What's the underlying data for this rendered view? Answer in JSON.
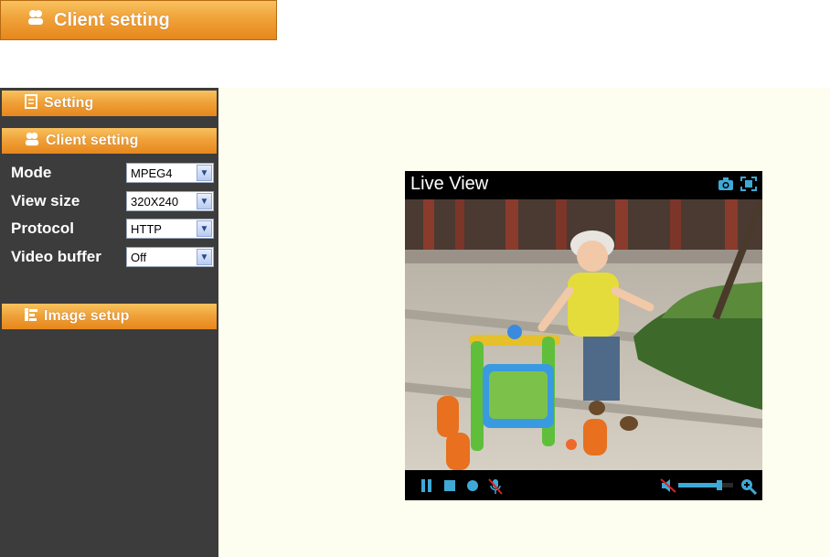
{
  "banner": {
    "title": "Client setting"
  },
  "sidebar": {
    "setting_label": "Setting",
    "client_setting_label": "Client setting",
    "image_setup_label": "Image setup",
    "fields": [
      {
        "label": "Mode",
        "value": "MPEG4"
      },
      {
        "label": "View size",
        "value": "320X240"
      },
      {
        "label": "Protocol",
        "value": "HTTP"
      },
      {
        "label": "Video buffer",
        "value": "Off"
      }
    ]
  },
  "viewer": {
    "title": "Live View",
    "volume_level": 0.75
  },
  "icons": {
    "banner": "users-icon",
    "setting": "document-icon",
    "client_setting": "users-icon",
    "image_setup": "image-setup-icon",
    "snapshot": "camera-icon",
    "fullscreen": "fullscreen-icon",
    "pause": "pause-icon",
    "stop": "stop-icon",
    "record": "record-icon",
    "mic_muted": "microphone-muted-icon",
    "speaker_muted": "speaker-muted-icon",
    "zoom": "zoom-in-icon"
  },
  "colors": {
    "accent": "#f0a23a",
    "sidebar": "#3c3c3c",
    "main_bg": "#fdfdf0",
    "control_blue": "#3fa9d6"
  }
}
